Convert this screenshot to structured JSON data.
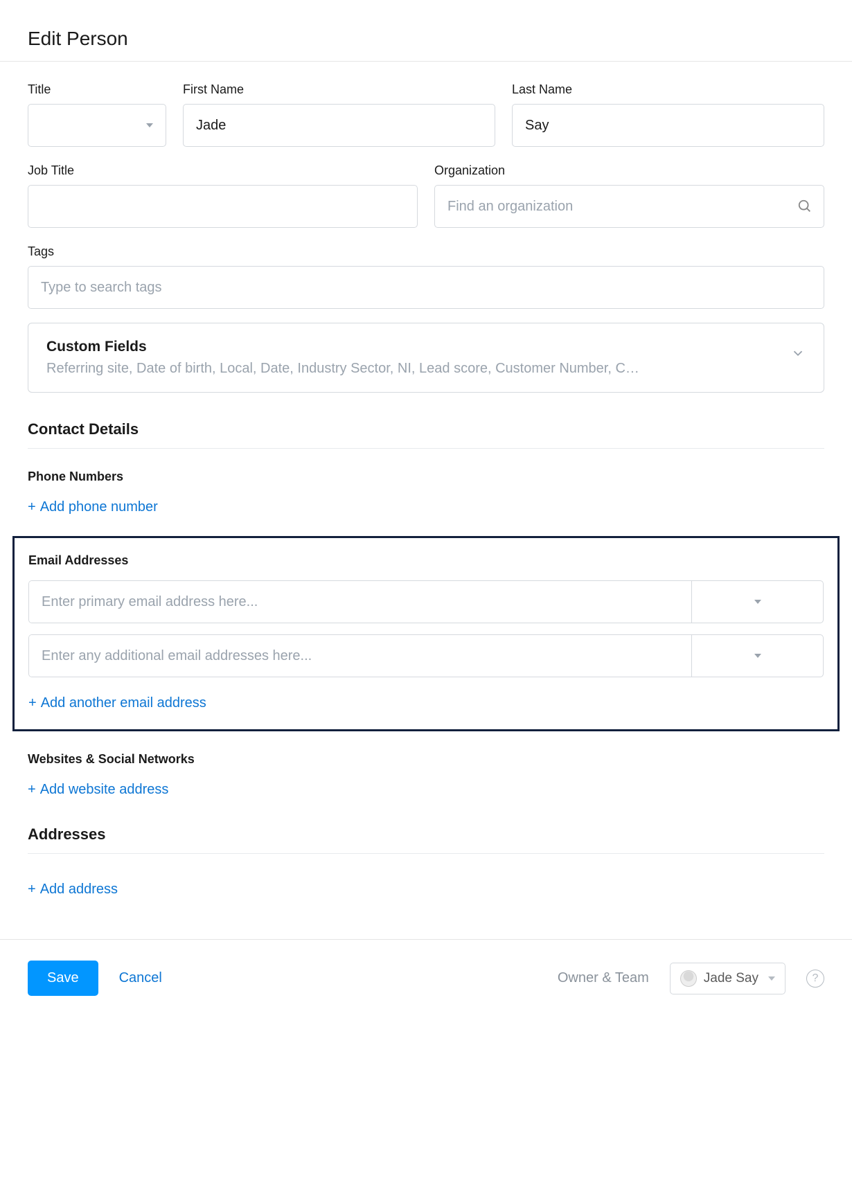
{
  "page_title": "Edit Person",
  "fields": {
    "title": {
      "label": "Title",
      "value": ""
    },
    "first_name": {
      "label": "First Name",
      "value": "Jade"
    },
    "last_name": {
      "label": "Last Name",
      "value": "Say"
    },
    "job_title": {
      "label": "Job Title",
      "value": ""
    },
    "organization": {
      "label": "Organization",
      "placeholder": "Find an organization",
      "value": ""
    },
    "tags": {
      "label": "Tags",
      "placeholder": "Type to search tags"
    }
  },
  "custom_fields": {
    "title": "Custom Fields",
    "summary": "Referring site, Date of birth, Local, Date, Industry Sector, NI, Lead score, Customer Number, C…"
  },
  "sections": {
    "contact_details": "Contact Details",
    "phone_numbers_label": "Phone Numbers",
    "add_phone": "Add phone number",
    "email_addresses_label": "Email Addresses",
    "email_primary_placeholder": "Enter primary email address here...",
    "email_additional_placeholder": "Enter any additional email addresses here...",
    "add_email": "Add another email address",
    "websites_label": "Websites & Social Networks",
    "add_website": "Add website address",
    "addresses": "Addresses",
    "add_address": "Add address"
  },
  "footer": {
    "save": "Save",
    "cancel": "Cancel",
    "owner_team_label": "Owner & Team",
    "owner_name": "Jade Say"
  },
  "plus": "+"
}
